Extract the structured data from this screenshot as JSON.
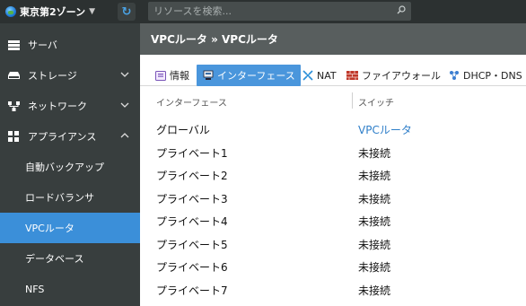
{
  "topbar": {
    "zone_label": "東京第2ゾーン",
    "search_placeholder": "リソースを検索..."
  },
  "sidebar": {
    "items": [
      {
        "label": "サーバ",
        "icon": "server-icon"
      },
      {
        "label": "ストレージ",
        "icon": "storage-icon"
      },
      {
        "label": "ネットワーク",
        "icon": "network-icon"
      },
      {
        "label": "アプライアンス",
        "icon": "appliance-icon"
      }
    ],
    "sub_items": [
      {
        "label": "自動バックアップ"
      },
      {
        "label": "ロードバランサ"
      },
      {
        "label": "VPCルータ",
        "active": true
      },
      {
        "label": "データベース"
      },
      {
        "label": "NFS"
      }
    ]
  },
  "main": {
    "breadcrumb": "VPCルータ » VPCルータ",
    "tabs": [
      {
        "label": "情報",
        "icon": "info-icon"
      },
      {
        "label": "インターフェース",
        "icon": "interface-icon",
        "active": true
      },
      {
        "label": "NAT",
        "icon": "nat-icon"
      },
      {
        "label": "ファイアウォール",
        "icon": "firewall-icon"
      },
      {
        "label": "DHCP・DNS",
        "icon": "dhcp-icon"
      }
    ],
    "table": {
      "headers": [
        "インターフェース",
        "スイッチ"
      ],
      "rows": [
        [
          "グローバル",
          "VPCルータ"
        ],
        [
          "プライベート1",
          "未接続"
        ],
        [
          "プライベート2",
          "未接続"
        ],
        [
          "プライベート3",
          "未接続"
        ],
        [
          "プライベート4",
          "未接続"
        ],
        [
          "プライベート5",
          "未接続"
        ],
        [
          "プライベート6",
          "未接続"
        ],
        [
          "プライベート7",
          "未接続"
        ]
      ]
    }
  },
  "colors": {
    "topbar": "#2c3131",
    "sidebar": "#383e3e",
    "active": "#3b8fd9",
    "link": "#2f7fc9"
  }
}
